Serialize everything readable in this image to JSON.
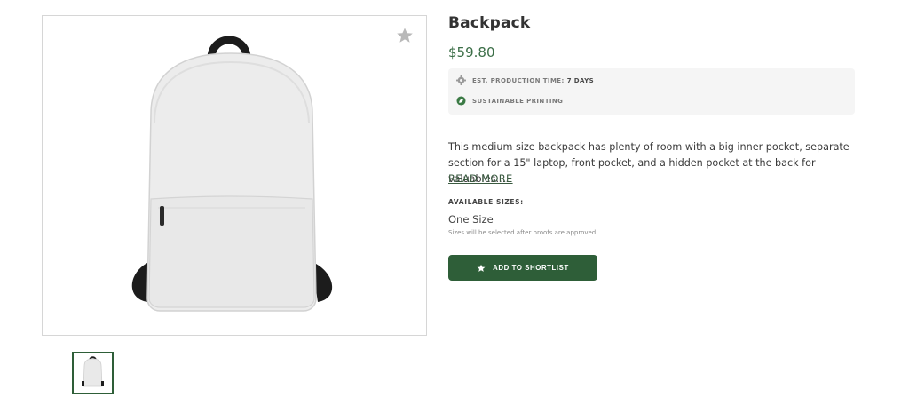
{
  "product": {
    "title": "Backpack",
    "price": "$59.80",
    "info": {
      "production_label": "EST. PRODUCTION TIME:",
      "production_value": "7 DAYS",
      "sustainable_label": "SUSTAINABLE PRINTING"
    },
    "description": "This medium size backpack has plenty of room with a big inner pocket, separate section for a 15\" laptop, front pocket, and a hidden pocket at the back for valuables.…",
    "read_more": "READ MORE",
    "sizes": {
      "label": "AVAILABLE SIZES:",
      "value": "One Size",
      "note": "Sizes will be selected after proofs are approved"
    },
    "shortlist_button": "ADD TO SHORTLIST"
  },
  "icons": {
    "favorite": "star-icon",
    "production": "gear-icon",
    "sustainable": "leaf-icon",
    "shortlist": "star-icon"
  },
  "colors": {
    "accent": "#2e5e38",
    "price": "#3b6e47",
    "info_bg": "#f5f5f5"
  }
}
